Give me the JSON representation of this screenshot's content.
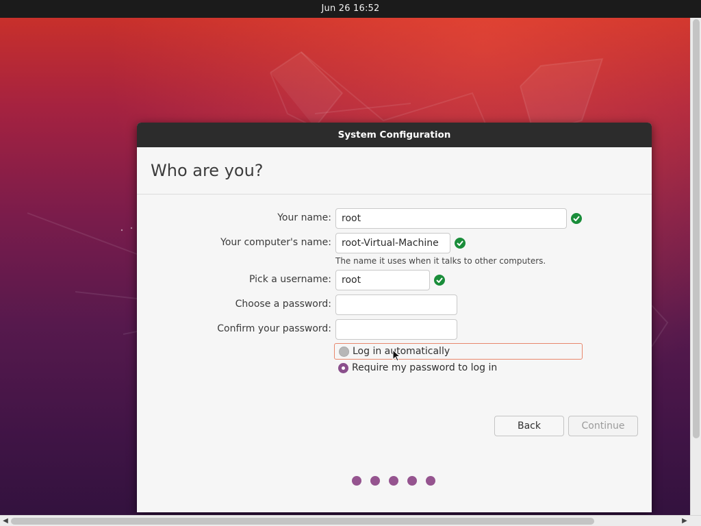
{
  "topbar": {
    "clock": "Jun 26  16:52"
  },
  "dialog": {
    "title": "System Configuration",
    "heading": "Who are you?",
    "fields": {
      "name": {
        "label": "Your name:",
        "value": "root"
      },
      "computer": {
        "label": "Your computer's name:",
        "value": "root-Virtual-Machine",
        "hint": "The name it uses when it talks to other computers."
      },
      "username": {
        "label": "Pick a username:",
        "value": "root"
      },
      "password": {
        "label": "Choose a password:",
        "value": ""
      },
      "confirm": {
        "label": "Confirm your password:",
        "value": ""
      }
    },
    "login_options": [
      {
        "label": "Log in automatically",
        "selected": false
      },
      {
        "label": "Require my password to log in",
        "selected": true
      }
    ],
    "buttons": {
      "back": "Back",
      "continue": "Continue"
    },
    "progress_dots": 5
  },
  "colors": {
    "accent": "#95548f",
    "valid_check": "#1a8d3a",
    "focus_border": "#e8866b",
    "titlebar": "#2c2c2c"
  },
  "icons": {
    "valid": "check-circle-icon",
    "cursor": "mouse-pointer-icon"
  }
}
